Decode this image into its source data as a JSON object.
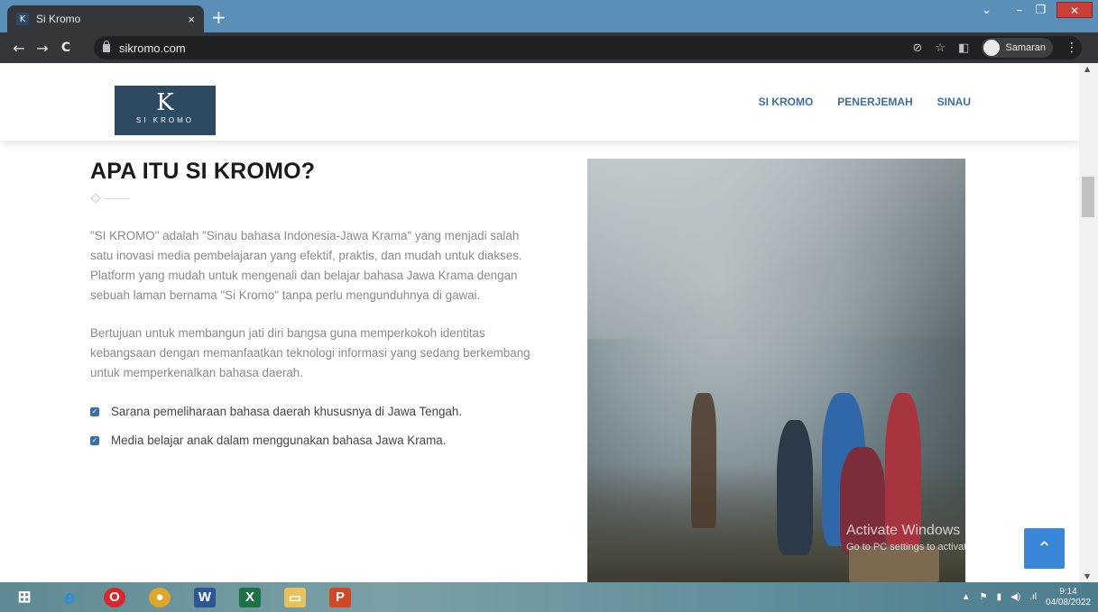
{
  "browser": {
    "tab_title": "Si Kromo",
    "tab_favicon": "K",
    "tab_close": "×",
    "new_tab": "+",
    "url": "sikromo.com",
    "profile_name": "Samaran",
    "nav": {
      "back": "←",
      "forward": "→",
      "reload": "C"
    }
  },
  "site": {
    "logo_letter": "K",
    "logo_text": "SI KROMO",
    "nav": [
      "SI KROMO",
      "PENERJEMAH",
      "SINAU"
    ]
  },
  "main": {
    "heading": "APA ITU SI KROMO?",
    "paragraphs": [
      "\"SI KROMO\" adalah \"Sinau bahasa Indonesia-Jawa Krama\" yang menjadi salah satu inovasi media pembelajaran yang efektif, praktis, dan mudah untuk diakses. Platform yang mudah untuk mengenali dan belajar bahasa Jawa Krama dengan sebuah laman bernama \"Si Kromo\" tanpa perlu mengunduhnya di gawai.",
      "Bertujuan untuk membangun jati diri bangsa guna memperkokoh identitas kebangsaan dengan memanfaatkan teknologi informasi yang sedang berkembang untuk memperkenalkan bahasa daerah."
    ],
    "checklist": [
      "Sarana pemeliharaan bahasa daerah khususnya di Jawa Tengah.",
      "Media belajar anak dalam menggunakan bahasa Jawa Krama."
    ]
  },
  "overlay": {
    "activate_title": "Activate Windows",
    "activate_sub": "Go to PC settings to activate Windows."
  },
  "taskbar": {
    "apps": [
      "windows-start",
      "internet-explorer",
      "opera",
      "chrome",
      "word",
      "excel",
      "file-explorer",
      "powerpoint"
    ],
    "time": "9:14",
    "date": "04/08/2022"
  }
}
